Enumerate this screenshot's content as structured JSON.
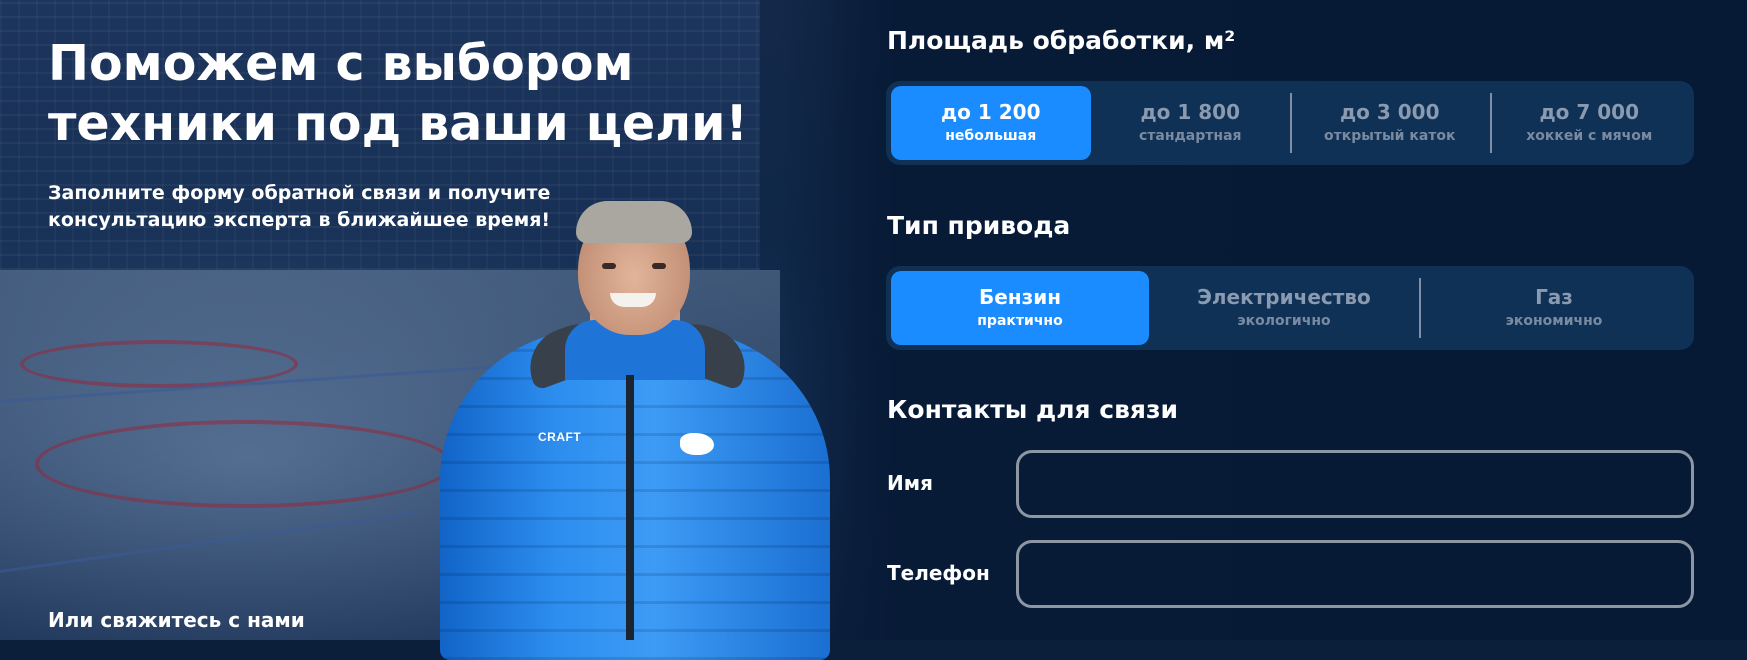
{
  "hero": {
    "title_line1": "Поможем с выбором",
    "title_line2": "техники под ваши цели!",
    "subtitle_line1": "Заполните форму обратной связи и получите",
    "subtitle_line2": "консультацию эксперта в ближайшее время!",
    "contact_text": "Или свяжитесь с нами",
    "jacket_logo": "CRAFT"
  },
  "area": {
    "title": "Площадь обработки, м²",
    "options": [
      {
        "label": "до 1 200",
        "sub": "небольшая",
        "selected": true
      },
      {
        "label": "до 1 800",
        "sub": "стандартная",
        "selected": false
      },
      {
        "label": "до 3 000",
        "sub": "открытый каток",
        "selected": false
      },
      {
        "label": "до 7 000",
        "sub": "хоккей с мячом",
        "selected": false
      }
    ]
  },
  "drive": {
    "title": "Тип привода",
    "options": [
      {
        "label": "Бензин",
        "sub": "практично",
        "selected": true
      },
      {
        "label": "Электричество",
        "sub": "экологично",
        "selected": false
      },
      {
        "label": "Газ",
        "sub": "экономично",
        "selected": false
      }
    ]
  },
  "contacts": {
    "title": "Контакты для связи",
    "name_label": "Имя",
    "name_value": "",
    "phone_label": "Телефон",
    "phone_value": ""
  },
  "colors": {
    "accent": "#1a8cff",
    "background": "#061a35",
    "segment_bg": "#0f3156"
  }
}
